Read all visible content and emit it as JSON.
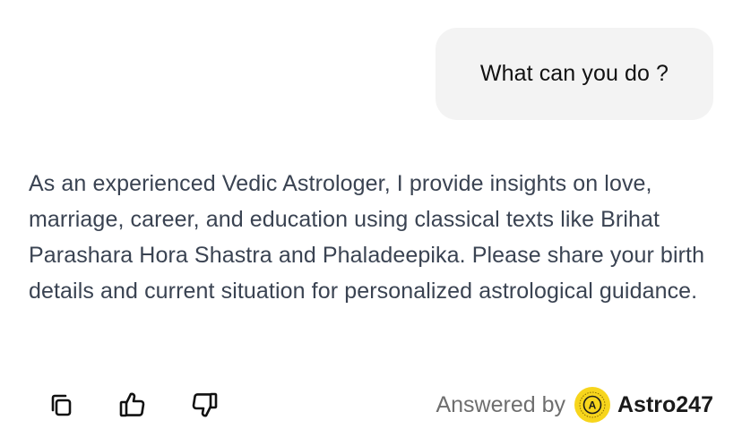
{
  "conversation": {
    "user_message": "What can you do ?",
    "assistant_message": "As an experienced Vedic Astrologer, I provide insights on love, marriage, career, and education using classical texts like Brihat Parashara Hora Shastra and Phaladeepika. Please share your birth details and current situation for personalized astrological guidance."
  },
  "actions": {
    "copy_icon": "copy-icon",
    "like_icon": "thumbs-up-icon",
    "dislike_icon": "thumbs-down-icon"
  },
  "attribution": {
    "label": "Answered by",
    "brand_name": "Astro247",
    "logo_letter": "A",
    "logo_color": "#f7d51c"
  },
  "colors": {
    "user_bubble_bg": "#f3f3f3",
    "assistant_text": "#3a4352",
    "muted_text": "#6e6e6e"
  }
}
